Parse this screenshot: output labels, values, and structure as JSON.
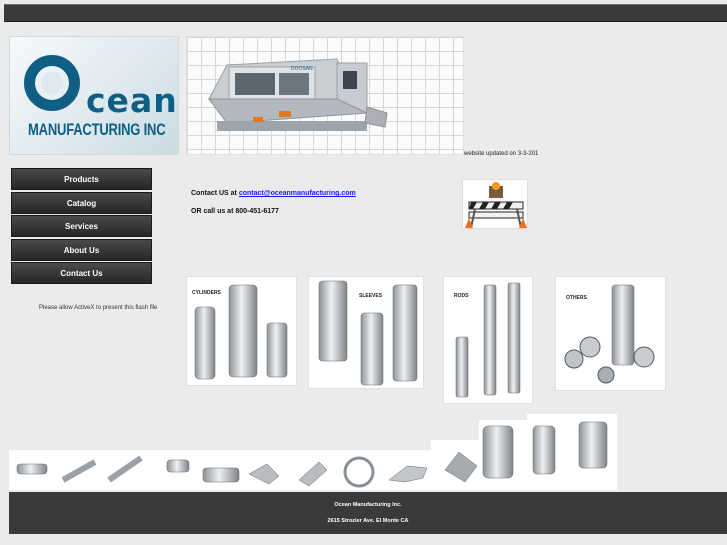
{
  "logo": {
    "letter": "O",
    "word": "cean",
    "subtitle": "MANUFACTURING INC"
  },
  "machine": {
    "brand": "DOOSAN"
  },
  "updated_text": "website updated on 3-3-201",
  "nav": [
    {
      "label": "Products"
    },
    {
      "label": "Catalog"
    },
    {
      "label": "Services"
    },
    {
      "label": "About Us"
    },
    {
      "label": "Contact Us"
    }
  ],
  "contact": {
    "line1_prefix": "Contact US at ",
    "email": "contact@oceanmanufacturing.com",
    "line2": "OR call us at 800-451-6177"
  },
  "flash_notice": "Please allow ActiveX to present this flash file",
  "product_cards": [
    {
      "label": "CYLINDERS"
    },
    {
      "label": "SLEEVES"
    },
    {
      "label": "RODS"
    },
    {
      "label": "OTHERS"
    }
  ],
  "footer": {
    "company": "Ocean Manufacturing Inc.",
    "address": "2615 Strozier Ave. El Monte CA"
  },
  "colors": {
    "brand_blue": "#0f5f84",
    "nav_bg": "#2f2f2f",
    "footer_bg": "#3a3a3a",
    "link": "#1a1aff"
  }
}
